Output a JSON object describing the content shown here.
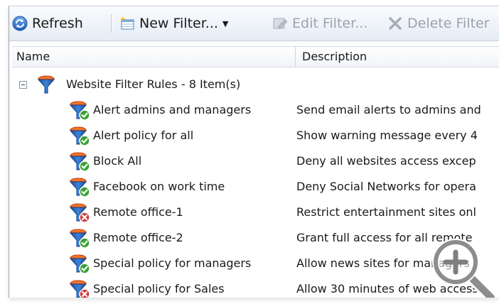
{
  "toolbar": {
    "refresh_label": "Refresh",
    "new_filter_label": "New Filter...",
    "edit_filter_label": "Edit Filter...",
    "delete_filter_label": "Delete Filter"
  },
  "columns": {
    "name": "Name",
    "description": "Description"
  },
  "group": {
    "label": "Website Filter Rules - 8 Item(s)"
  },
  "rules": [
    {
      "name": "Alert admins and managers",
      "description": "Send email alerts to admins and",
      "status": "enabled"
    },
    {
      "name": "Alert policy for all",
      "description": "Show warning message every 4",
      "status": "enabled"
    },
    {
      "name": "Block All",
      "description": "Deny all websites access excep",
      "status": "enabled"
    },
    {
      "name": "Facebook on work time",
      "description": "Deny Social Networks for opera",
      "status": "enabled"
    },
    {
      "name": "Remote office-1",
      "description": "Restrict entertainment sites onl",
      "status": "disabled"
    },
    {
      "name": "Remote office-2",
      "description": "Grant full access for all remote",
      "status": "enabled"
    },
    {
      "name": "Special policy for managers",
      "description": "Allow news sites for managers",
      "status": "enabled"
    },
    {
      "name": "Special policy for Sales",
      "description": "Allow 30 minutes of web access",
      "status": "disabled"
    }
  ],
  "colors": {
    "enabled": "#3aa335",
    "disabled": "#d23b3b",
    "accent": "#2c6fc4"
  },
  "icons": {
    "refresh": "refresh-icon",
    "new": "new-filter-icon",
    "edit": "edit-filter-icon",
    "delete": "delete-icon",
    "zoom": "zoom-in-icon",
    "rule": "filter-funnel-icon"
  }
}
